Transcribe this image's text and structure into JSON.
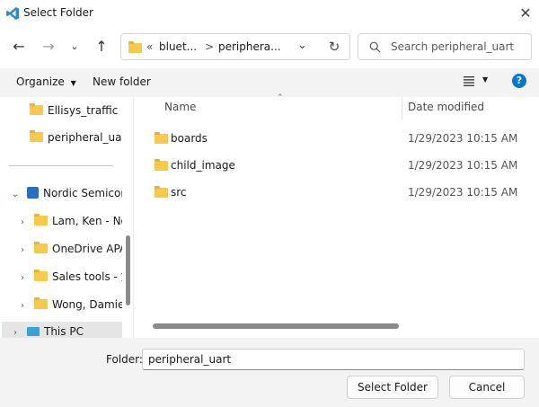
{
  "window": {
    "title": "Select Folder"
  },
  "address": {
    "overflow": "«",
    "segments": [
      "bluet...",
      "periphera..."
    ],
    "separator": ">"
  },
  "search": {
    "placeholder": "Search peripheral_uart"
  },
  "toolbar": {
    "organize_label": "Organize",
    "new_folder_label": "New folder"
  },
  "nav": {
    "quick_items": [
      "Ellisys_traffic",
      "peripheral_uart"
    ],
    "nordic": "Nordic Semicon",
    "sub_items": [
      "Lam, Ken - Nor",
      "OneDrive APAC",
      "Sales tools - 文",
      "Wong, Damien"
    ],
    "this_pc": "This PC"
  },
  "files": {
    "columns": {
      "name": "Name",
      "date": "Date modified"
    },
    "rows": [
      {
        "name": "boards",
        "date": "1/29/2023 10:15 AM"
      },
      {
        "name": "child_image",
        "date": "1/29/2023 10:15 AM"
      },
      {
        "name": "src",
        "date": "1/29/2023 10:15 AM"
      }
    ]
  },
  "footer": {
    "folder_label": "Folder:",
    "folder_value": "peripheral_uart",
    "select_label": "Select Folder",
    "cancel_label": "Cancel"
  },
  "colors": {
    "accent": "#0078d4",
    "folder": "#f7c948",
    "vscode_blue": "#2a8ad4"
  }
}
